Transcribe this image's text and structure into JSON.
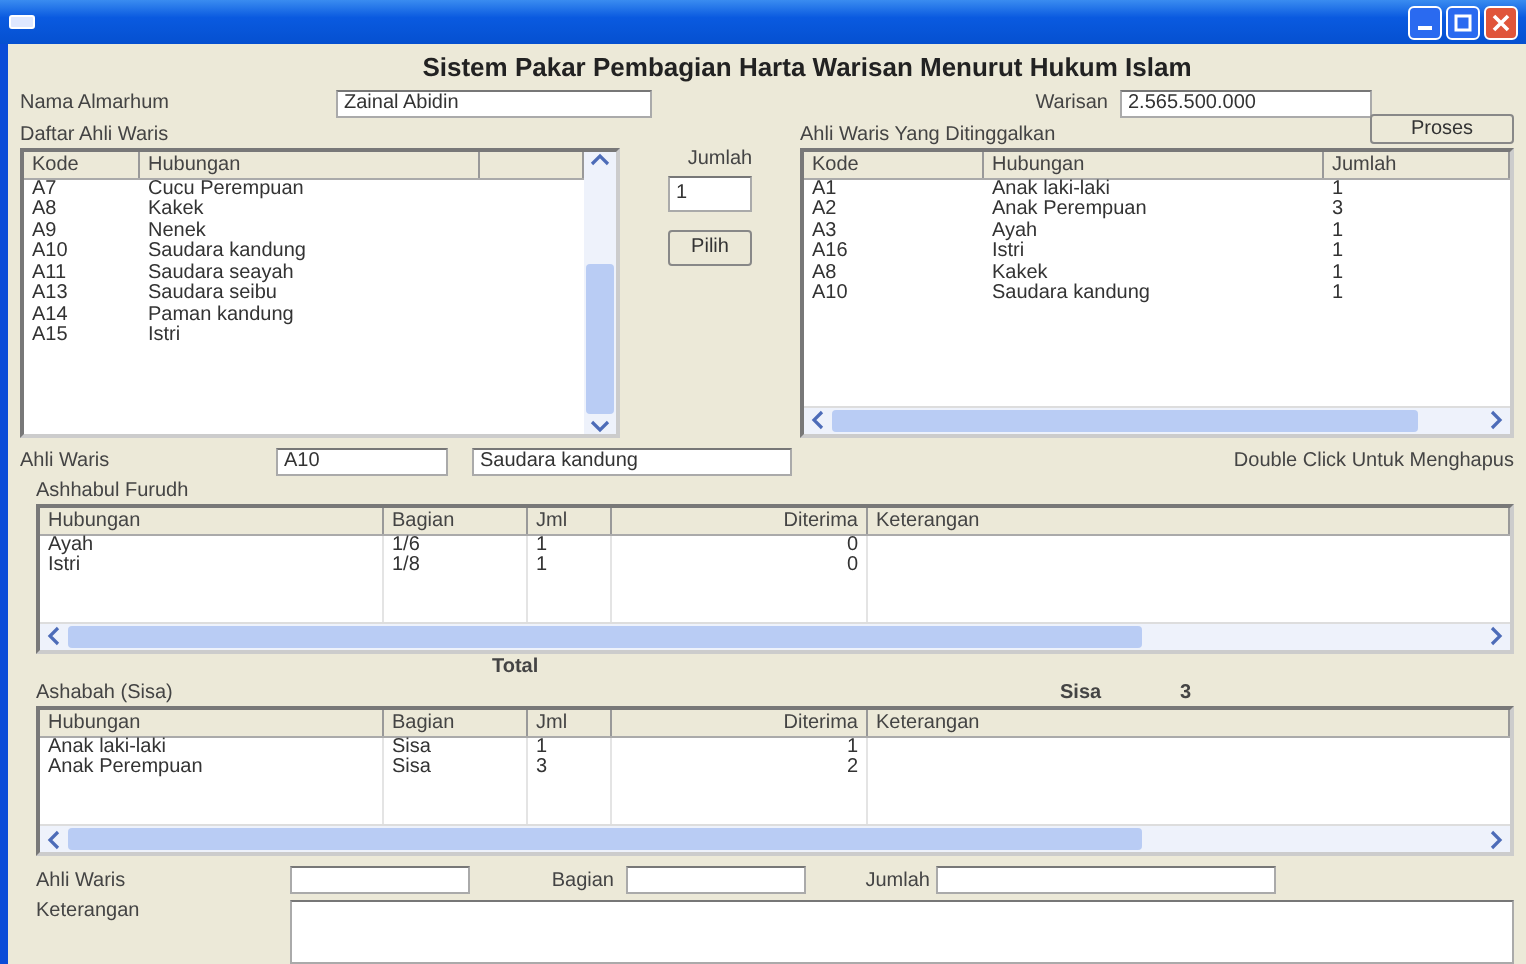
{
  "window": {
    "heading": "Sistem Pakar Pembagian Harta Warisan Menurut  Hukum Islam"
  },
  "nama_almarhum": {
    "label": "Nama Almarhum",
    "value": "Zainal Abidin"
  },
  "warisan": {
    "label": "Warisan",
    "value": "2.565.500.000"
  },
  "daftar_ahli_waris": {
    "label": "Daftar Ahli Waris",
    "columns": [
      "Kode",
      "Hubungan"
    ],
    "rows": [
      [
        "A7",
        "Cucu Perempuan"
      ],
      [
        "A8",
        "Kakek"
      ],
      [
        "A9",
        "Nenek"
      ],
      [
        "A10",
        "Saudara kandung"
      ],
      [
        "A11",
        "Saudara seayah"
      ],
      [
        "A13",
        "Saudara seibu"
      ],
      [
        "A14",
        "Paman kandung"
      ],
      [
        "A15",
        "Istri"
      ]
    ]
  },
  "jumlah": {
    "label": "Jumlah",
    "value": "1"
  },
  "pilih_button": "Pilih",
  "ahli_waris_ditinggalkan": {
    "label": "Ahli Waris Yang Ditinggalkan",
    "columns": [
      "Kode",
      "Hubungan",
      "Jumlah"
    ],
    "rows": [
      [
        "A1",
        "Anak laki-laki",
        "1"
      ],
      [
        "A2",
        "Anak Perempuan",
        "3"
      ],
      [
        "A3",
        "Ayah",
        "1"
      ],
      [
        "A16",
        "Istri",
        "1"
      ],
      [
        "A8",
        "Kakek",
        "1"
      ],
      [
        "A10",
        "Saudara kandung",
        "1"
      ]
    ]
  },
  "proses_button": "Proses",
  "selected_heir": {
    "label": "Ahli Waris",
    "kode": "A10",
    "hubungan": "Saudara kandung"
  },
  "hint": "Double Click Untuk Menghapus",
  "ashhabul_furudh": {
    "label": "Ashhabul Furudh",
    "columns": [
      "Hubungan",
      "Bagian",
      "Jml",
      "Diterima",
      "Keterangan"
    ],
    "rows": [
      [
        "Ayah",
        "1/6",
        "1",
        "0"
      ],
      [
        "Istri",
        "1/8",
        "1",
        "0"
      ]
    ]
  },
  "total_label": "Total",
  "ashabah": {
    "label": "Ashabah (Sisa)",
    "columns": [
      "Hubungan",
      "Bagian",
      "Jml",
      "Diterima",
      "Keterangan"
    ],
    "rows": [
      [
        "Anak laki-laki",
        "Sisa",
        "1",
        "1"
      ],
      [
        "Anak Perempuan",
        "Sisa",
        "3",
        "2"
      ]
    ]
  },
  "sisa": {
    "label": "Sisa",
    "value": "3"
  },
  "detail": {
    "ahli_waris_label": "Ahli Waris",
    "bagian_label": "Bagian",
    "jumlah_label": "Jumlah",
    "keterangan_label": "Keterangan"
  }
}
